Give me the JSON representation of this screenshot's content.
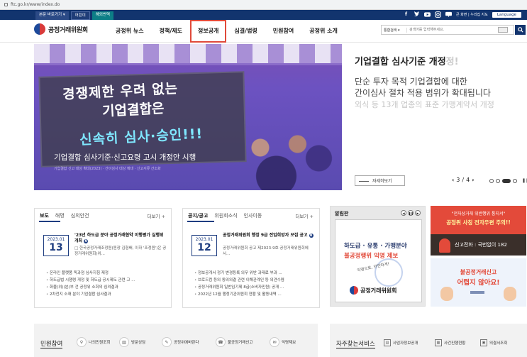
{
  "browser": {
    "url": "ftc.go.kr/www/index.do"
  },
  "topbar": {
    "links": [
      "본문 바로가기 ▾",
      "어린이",
      "해외번역"
    ],
    "sns": [
      "f-icon",
      "twitter-icon",
      "youtube-icon",
      "instagram-icon",
      "blog-icon"
    ],
    "util": "큰 화면  |  누리집 지도",
    "language": "Language"
  },
  "header": {
    "logo_text": "공정거래위원회",
    "nav": [
      "공정위 뉴스",
      "정책/제도",
      "정보공개",
      "심결/법령",
      "민원참여",
      "공정위 소개"
    ],
    "active_nav": "정보공개",
    "search": {
      "select": "통합검색 ▾",
      "placeholder": "검색어를 입력해주세요."
    }
  },
  "hero": {
    "line1": "경쟁제한 우려 없는",
    "line2": "기업결합은",
    "line3": "신속히 심사·승인!!!",
    "caption": "기업결합 심사기준·신고요령 고시 개정안 시행",
    "small": "기업결합 신고 대상 확대(2023) · 간이심사 대상 확대 · 신고서류 간소화",
    "title_main": "기업결합 심사기준 개정",
    "title_fade": "정!",
    "desc1": "단순 투자 목적 기업결합에 대한",
    "desc2": "간이심사 절차 적용 범위가 확대됩니다",
    "desc3": "외식 등 13개 업종의 표준 가맹계약서 개정",
    "more": "자세히보기",
    "pager": {
      "current": "3",
      "sep": "/",
      "total": "4"
    }
  },
  "panel1": {
    "tabs": [
      "보도",
      "해명",
      "심의안건"
    ],
    "more": "더보기 +",
    "date_ym": "2023.01",
    "date_d": "13",
    "feat_title": "'23년 하도급 분야 공정거래협약 이행평가 실행위 개최",
    "feat_sub": "□ 한국공정거래조정원(원장 김형배, 이하 '조정원')은 공정거래위원회(위...",
    "items": [
      "온라인 플랫폼 독과점 심사지침 제정",
      "하도급법 시행령 개정 및 하도급 공시제도 관련 고 ...",
      "화물(위)(분)부 건 공정위 소회의 심의결과",
      "2차전지 소재 분야 기업결합 심사결과"
    ]
  },
  "panel2": {
    "tabs": [
      "공지/공고",
      "위원회소식",
      "인사이동"
    ],
    "more": "더보기 +",
    "date_ym": "2023.01",
    "date_d": "12",
    "feat_title": "공정거래위원회 행정 9급 전입희망자 모집 공고",
    "feat_sub": "공정거래위원회 공고 제2023-9호 공정거래위원회에서...",
    "items": [
      "정보공개서 정기 변경등록 의무 위반 과태료 부과 ...",
      "브로드컴 등의 동의의결 관련 이해관계인 등 의견수렴",
      "공정거래위원회 일반임기제 8급(소비자민원) 공개 ...",
      "2022년 12월 행정기관위원회 현황 및 활동내역 ..."
    ]
  },
  "notice": {
    "title": "알림판",
    "line1": "하도급 · 유통 · 가맹분야",
    "line2": "불공정행위 익명 제보",
    "line3": "익명으로, 안전하게!",
    "logo": "공정거래위원회"
  },
  "ad1": {
    "line1": "\"전자상거래 위반행위 통지서\"",
    "line2": "공정위 사칭 전자우편 주의!!",
    "line3": "신고전화 : 국번없이 182"
  },
  "ad2": {
    "line1": "불공정거래신고",
    "line2": "어렵지 않아요!"
  },
  "civil": {
    "label": "민원참여",
    "items": [
      "나의민원조회",
      "방문상담",
      "공정위에바란다",
      "불공정거래신고",
      "익명제보"
    ]
  },
  "services": {
    "label": "자주찾는서비스",
    "items": [
      "사업자정보공개",
      "사건진행현황",
      "의결서조회"
    ]
  }
}
